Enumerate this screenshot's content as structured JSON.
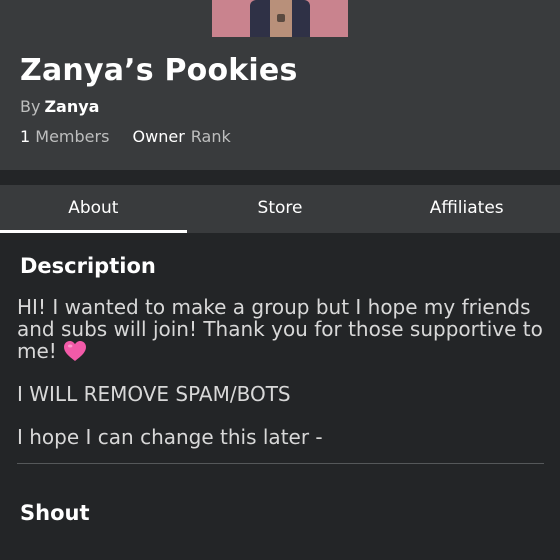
{
  "group": {
    "name": "Zanya’s Pookies",
    "by_label": "By",
    "owner": "Zanya",
    "member_count": "1",
    "members_label": "Members",
    "role": "Owner",
    "rank_label": "Rank"
  },
  "tabs": [
    {
      "label": "About",
      "active": true
    },
    {
      "label": "Store",
      "active": false
    },
    {
      "label": "Affiliates",
      "active": false
    }
  ],
  "about": {
    "description_title": "Description",
    "description_paragraphs": [
      "HI! I wanted to make a group but I hope my friends and subs will join! Thank you for those supportive to me!",
      "I WILL REMOVE SPAM/BOTS",
      "I hope I can change this later -"
    ],
    "shout_title": "Shout"
  },
  "icons": {
    "emoji": "pink-heart-icon",
    "emblem": "group-emblem"
  },
  "colors": {
    "background": "#232527",
    "panel": "#393b3d",
    "text": "#ffffff",
    "muted": "#bdbebe",
    "heart": "#f25aa8"
  }
}
